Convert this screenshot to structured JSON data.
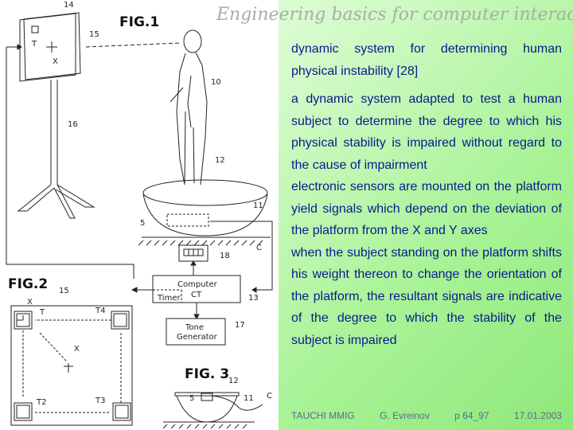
{
  "slide": {
    "title": "Engineering basics for computer interaction",
    "colors": {
      "title": "#a9aca9",
      "body_text": "#0a1a8c",
      "footer_text": "#5a6a8a",
      "background_start": "#f4fff0",
      "background_end": "#8ee87a"
    }
  },
  "bullets": [
    "dynamic system for determining human physical instability [28]",
    "a dynamic system adapted to test a human subject to determine the degree to which his physical stability is impaired without regard to the cause of impairment",
    "electronic sensors are mounted on the platform yield signals which depend on the deviation of the platform from the X and Y axes",
    "when the subject standing on the platform shifts his weight thereon to change the orientation of the platform, the resultant signals are indicative of the degree to which the stability of the subject is impaired"
  ],
  "footer": {
    "org": "TAUCHI MMIG",
    "author": "G. Evreinov",
    "page": "p 64_97",
    "date": "17.01.2003"
  },
  "figure": {
    "fig1_title": "FIG.1",
    "fig2_title": "FIG.2",
    "fig3_title": "FIG. 3",
    "labels": {
      "l14": "14",
      "l15": "15",
      "l16": "16",
      "l10": "10",
      "l12": "12",
      "l11": "11",
      "l5": "5",
      "lC": "C",
      "l18": "18",
      "l13": "13",
      "l17": "17",
      "lT": "T",
      "lX": "X",
      "lT2": "T2",
      "lT3": "T3",
      "lT4": "T4"
    },
    "computer_box": "Computer",
    "timer_label": "Timer",
    "ct_label": "CT",
    "tone_line1": "Tone",
    "tone_line2": "Generator"
  }
}
